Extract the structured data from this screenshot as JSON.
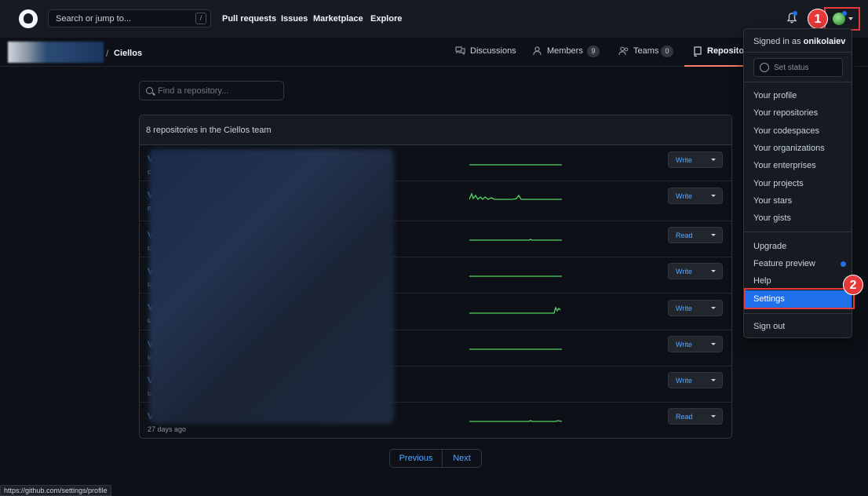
{
  "header": {
    "search_placeholder": "Search or jump to...",
    "search_shortcut": "/",
    "nav": [
      "Pull requests",
      "Issues",
      "Marketplace",
      "Explore"
    ]
  },
  "breadcrumb": {
    "separator": "/",
    "team": "Ciellos"
  },
  "tabs": {
    "discussions": "Discussions",
    "members": "Members",
    "members_count": "9",
    "teams": "Teams",
    "teams_count": "0",
    "repositories": "Repositori"
  },
  "find_placeholder": "Find a repository...",
  "repo_box": {
    "title": "8 repositories in the Ciellos team",
    "rows": [
      {
        "initial": "V",
        "sub": "c",
        "permission": "Write"
      },
      {
        "initial": "V",
        "sub": "m",
        "permission": "Write"
      },
      {
        "initial": "V",
        "sub": "u",
        "permission": "Read"
      },
      {
        "initial": "V",
        "sub": "u",
        "permission": "Write"
      },
      {
        "initial": "V",
        "sub": "u",
        "permission": "Write"
      },
      {
        "initial": "V",
        "sub": "u",
        "permission": "Write"
      },
      {
        "initial": "V",
        "sub": "u",
        "permission": "Write"
      },
      {
        "initial": "V",
        "sub": "27 days ago",
        "permission": "Read"
      }
    ]
  },
  "pagination": {
    "previous": "Previous",
    "next": "Next"
  },
  "dropdown": {
    "signed_in_prefix": "Signed in as",
    "username": "onikolaiev",
    "set_status": "Set status",
    "profile_items": [
      "Your profile",
      "Your repositories",
      "Your codespaces",
      "Your organizations",
      "Your enterprises",
      "Your projects",
      "Your stars",
      "Your gists"
    ],
    "upgrade": "Upgrade",
    "feature_preview": "Feature preview",
    "help": "Help",
    "settings": "Settings",
    "sign_out": "Sign out"
  },
  "annotations": {
    "badge_1": "1",
    "badge_2": "2"
  },
  "status_url": "https://github.com/settings/profile",
  "colors": {
    "accent_blue": "#1f6feb",
    "link_blue": "#58a6ff",
    "annotation_red": "#e5393a",
    "sparkline_green": "#56d364",
    "tab_underline": "#f78166"
  }
}
